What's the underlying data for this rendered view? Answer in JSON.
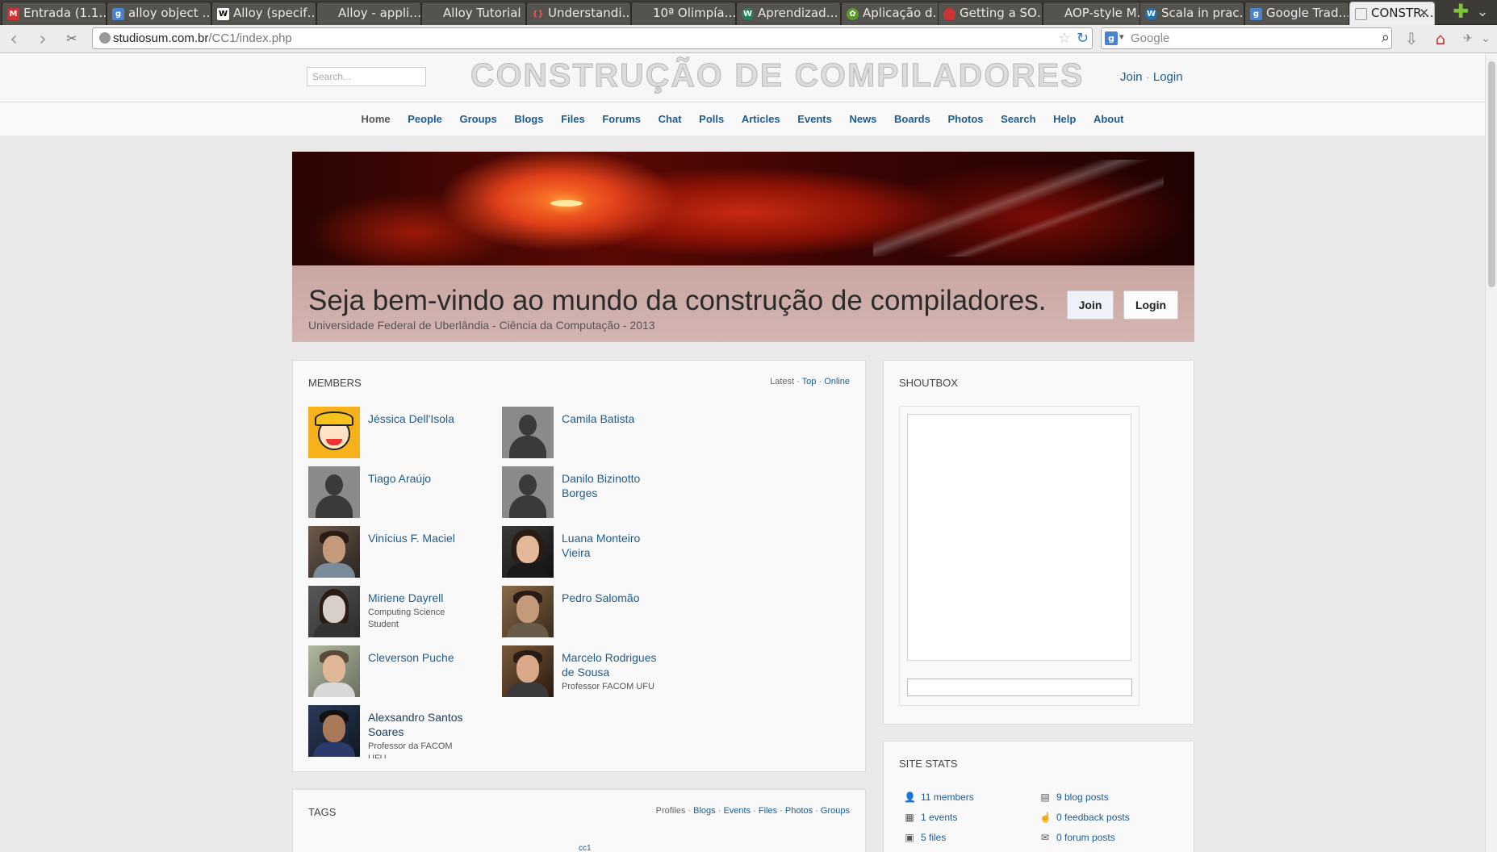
{
  "browser": {
    "tabs": [
      {
        "title": "Entrada (1.1…",
        "favicon": "gmail-icon",
        "color": "#c33"
      },
      {
        "title": "alloy object …",
        "favicon": "google-icon",
        "color": "#4a82d0"
      },
      {
        "title": "Alloy (specif…",
        "favicon": "wikipedia-icon",
        "color": "#fff"
      },
      {
        "title": "Alloy - appli…",
        "favicon": "page-icon",
        "color": "#777"
      },
      {
        "title": "Alloy Tutorial",
        "favicon": "page-icon",
        "color": "#777"
      },
      {
        "title": "Understandi…",
        "favicon": "braces-icon",
        "color": "#c33"
      },
      {
        "title": "10ª Olimpía…",
        "favicon": "page-icon",
        "color": "#777"
      },
      {
        "title": "Aprendizad…",
        "favicon": "wordpress-icon",
        "color": "#2a7c5f"
      },
      {
        "title": "Aplicação d…",
        "favicon": "leaf-icon",
        "color": "#5a9a2a"
      },
      {
        "title": "Getting a SO…",
        "favicon": "shield-icon",
        "color": "#c33"
      },
      {
        "title": "AOP-style M…",
        "favicon": "page-icon",
        "color": "#777"
      },
      {
        "title": "Scala in prac…",
        "favicon": "wordpress-icon",
        "color": "#2271b1"
      },
      {
        "title": "Google Trad…",
        "favicon": "google-translate-icon",
        "color": "#4a82d0"
      },
      {
        "title": "CONSTR…",
        "favicon": "page-icon",
        "color": "#999",
        "active": true
      }
    ],
    "url_host": "studiosum.com.br",
    "url_path": "/CC1/index.php",
    "search_placeholder": "Google"
  },
  "site": {
    "search_placeholder": "Search...",
    "title": "CONSTRUÇÃO DE COMPILADORES",
    "join": "Join",
    "separator": "·",
    "login": "Login",
    "nav": [
      "Home",
      "People",
      "Groups",
      "Blogs",
      "Files",
      "Forums",
      "Chat",
      "Polls",
      "Articles",
      "Events",
      "News",
      "Boards",
      "Photos",
      "Search",
      "Help",
      "About"
    ]
  },
  "banner": {
    "welcome": "Seja bem-vindo ao mundo da construção de compiladores.",
    "subtitle": "Universidade Federal de Uberlândia - Ciência da Computação - 2013",
    "join_button": "Join",
    "login_button": "Login"
  },
  "members": {
    "title": "MEMBERS",
    "filter_latest": "Latest",
    "filter_top": "Top",
    "filter_online": "Online",
    "list": [
      {
        "name": "Jéssica Dell'Isola",
        "sub": "",
        "avatar": "cartoon"
      },
      {
        "name": "Camila Batista",
        "sub": "",
        "avatar": "silhouette"
      },
      {
        "name": "Tiago Araújo",
        "sub": "",
        "avatar": "silhouette"
      },
      {
        "name": "Danilo Bizinotto Borges",
        "sub": "",
        "avatar": "silhouette"
      },
      {
        "name": "Vinícius F. Maciel",
        "sub": "",
        "avatar": "photo"
      },
      {
        "name": "Luana Monteiro Vieira",
        "sub": "",
        "avatar": "photo"
      },
      {
        "name": "Miriene Dayrell",
        "sub": "Computing Science Student",
        "avatar": "photo"
      },
      {
        "name": "Pedro Salomão",
        "sub": "",
        "avatar": "photo"
      },
      {
        "name": "Cleverson Puche",
        "sub": "",
        "avatar": "photo"
      },
      {
        "name": "Marcelo Rodrigues de Sousa",
        "sub": "Professor FACOM UFU",
        "avatar": "photo"
      },
      {
        "name": "Alexsandro Santos Soares",
        "sub": "Professor da FACOM UFU",
        "avatar": "photo"
      }
    ]
  },
  "tags": {
    "title": "TAGS",
    "filters": [
      "Profiles",
      "Blogs",
      "Events",
      "Files",
      "Photos",
      "Groups"
    ],
    "cloud": [
      "cc1"
    ]
  },
  "shoutbox": {
    "title": "SHOUTBOX"
  },
  "stats": {
    "title": "SITE STATS",
    "items": [
      {
        "label": "11 members",
        "icon": "user-icon"
      },
      {
        "label": "9 blog posts",
        "icon": "book-icon"
      },
      {
        "label": "1 events",
        "icon": "calendar-icon"
      },
      {
        "label": "0 feedback posts",
        "icon": "thumbs-up-icon"
      },
      {
        "label": "5 files",
        "icon": "disk-icon"
      },
      {
        "label": "0 forum posts",
        "icon": "comments-icon"
      }
    ]
  }
}
